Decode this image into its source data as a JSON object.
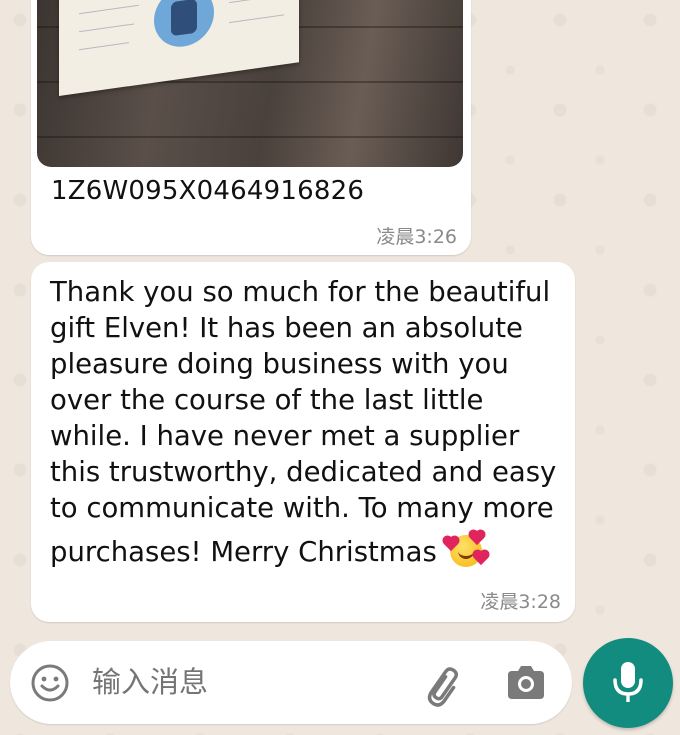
{
  "messages": [
    {
      "type": "photo",
      "caption": "1Z6W095X0464916826",
      "time": "凌晨3:26"
    },
    {
      "type": "text",
      "lines": [
        "Thank you so much for the beautiful",
        "gift Elven! It has been an absolute",
        "pleasure doing business with you",
        "over the course of the last little",
        "while. I have never met a supplier",
        "this trustworthy, dedicated and easy",
        "to communicate with. To many more",
        "purchases! Merry Christmas"
      ],
      "emoji": "smiling-face-with-hearts",
      "time": "凌晨3:28"
    }
  ],
  "composer": {
    "placeholder": "输入消息",
    "icons": [
      "emoji-icon",
      "paperclip-icon",
      "camera-icon",
      "microphone-icon"
    ]
  },
  "colors": {
    "bubble": "#FFFFFF",
    "wallpaper": "#EFE7DE",
    "mic_button": "#128C7E",
    "timestamp": "#8A8A8A"
  }
}
